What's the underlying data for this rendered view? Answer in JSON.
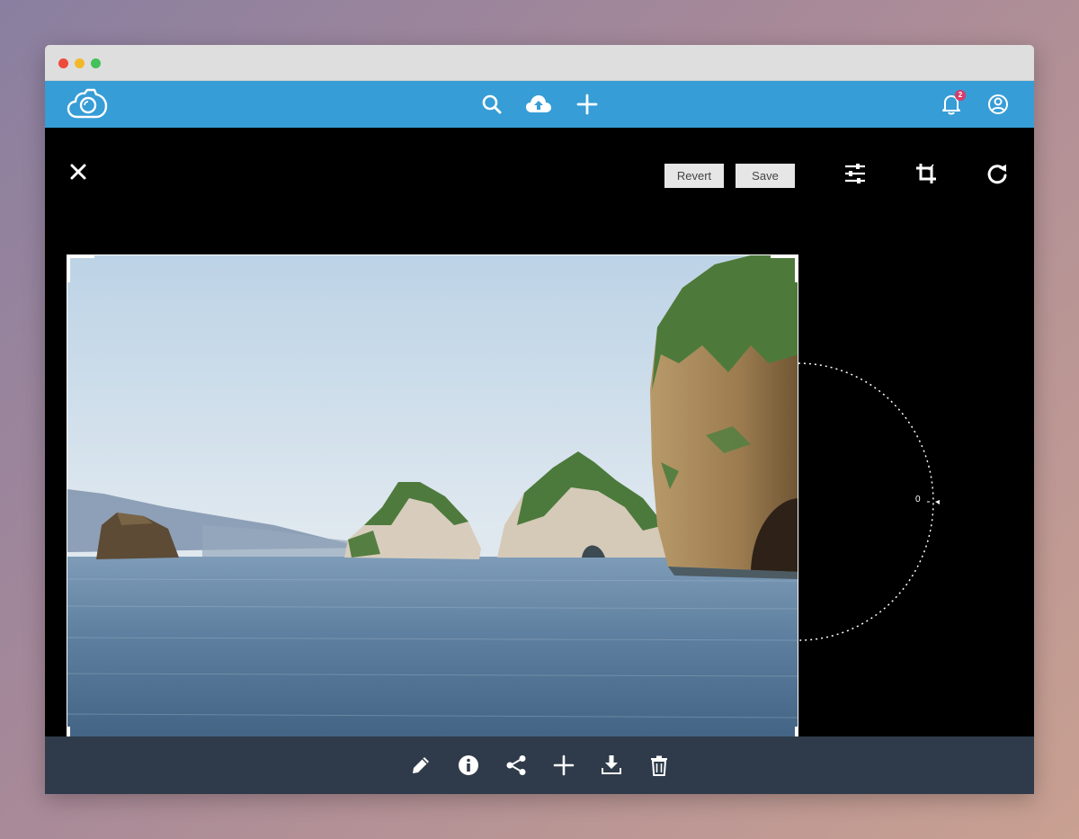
{
  "window": {
    "traffic_lights": [
      "close",
      "minimize",
      "zoom"
    ]
  },
  "appbar": {
    "logo_icon": "camera-cloud-logo",
    "center_icons": [
      "search-icon",
      "cloud-upload-icon",
      "plus-icon"
    ],
    "notifications_count": "2",
    "right_icons": [
      "bell-icon",
      "user-circle-icon"
    ]
  },
  "editor": {
    "revert_label": "Revert",
    "save_label": "Save",
    "tools": [
      "sliders-icon",
      "crop-icon",
      "rotate-icon"
    ],
    "rotation_value": "0"
  },
  "bottombar": {
    "icons": [
      "pencil-icon",
      "info-icon",
      "share-icon",
      "plus-icon",
      "download-icon",
      "trash-icon"
    ]
  },
  "colors": {
    "appbar": "#369dd6",
    "bottombar": "#2f3b4a",
    "editor_bg": "#000000",
    "badge": "#d63c6a"
  }
}
